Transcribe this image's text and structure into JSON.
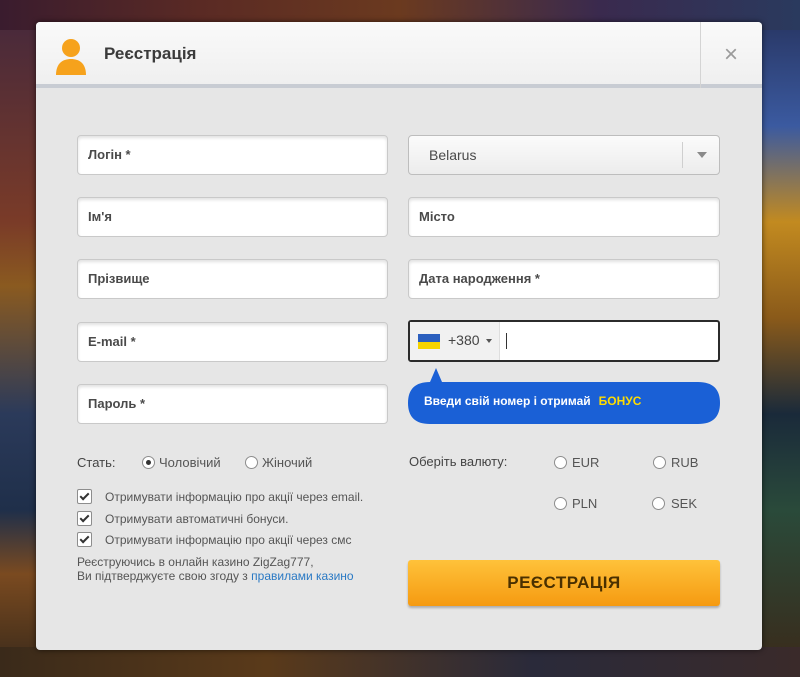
{
  "modal": {
    "title": "Реєстрація",
    "close_symbol": "×"
  },
  "form": {
    "login_placeholder": "Логін *",
    "first_name_placeholder": "Ім'я",
    "last_name_placeholder": "Прізвище",
    "email_placeholder": "E-mail *",
    "password_placeholder": "Пароль *",
    "country_value": "Belarus",
    "city_placeholder": "Місто",
    "birthdate_placeholder": "Дата народження *",
    "phone_dial_code": "+380",
    "phone_flag": "ukraine-flag"
  },
  "bonus_bubble": {
    "text": "Введи свій номер і отримай",
    "bonus": "БОНУС",
    "color": "#1a60d6"
  },
  "gender": {
    "label": "Стать:",
    "options": [
      "Чоловічий",
      "Жіночий"
    ],
    "selected": "Чоловічий"
  },
  "currency": {
    "label": "Оберіть валюту:",
    "options": [
      "EUR",
      "RUB",
      "PLN",
      "SEK"
    ]
  },
  "checkboxes": [
    {
      "label": "Отримувати інформацію про акції через email.",
      "checked": true
    },
    {
      "label": "Отримувати автоматичні бонуси.",
      "checked": true
    },
    {
      "label": "Отримувати інформацію про акції через смс",
      "checked": true
    }
  ],
  "terms": {
    "line1": "Реєструючись в онлайн казино ZigZag777,",
    "line2": "Ви підтверджуєте свою згоду з",
    "link": "правилами казино"
  },
  "register_button": "РЕЄСТРАЦІЯ",
  "colors": {
    "accent_orange": "#f7a51c",
    "bubble_blue": "#1a60d6",
    "link_blue": "#2a79c4"
  }
}
